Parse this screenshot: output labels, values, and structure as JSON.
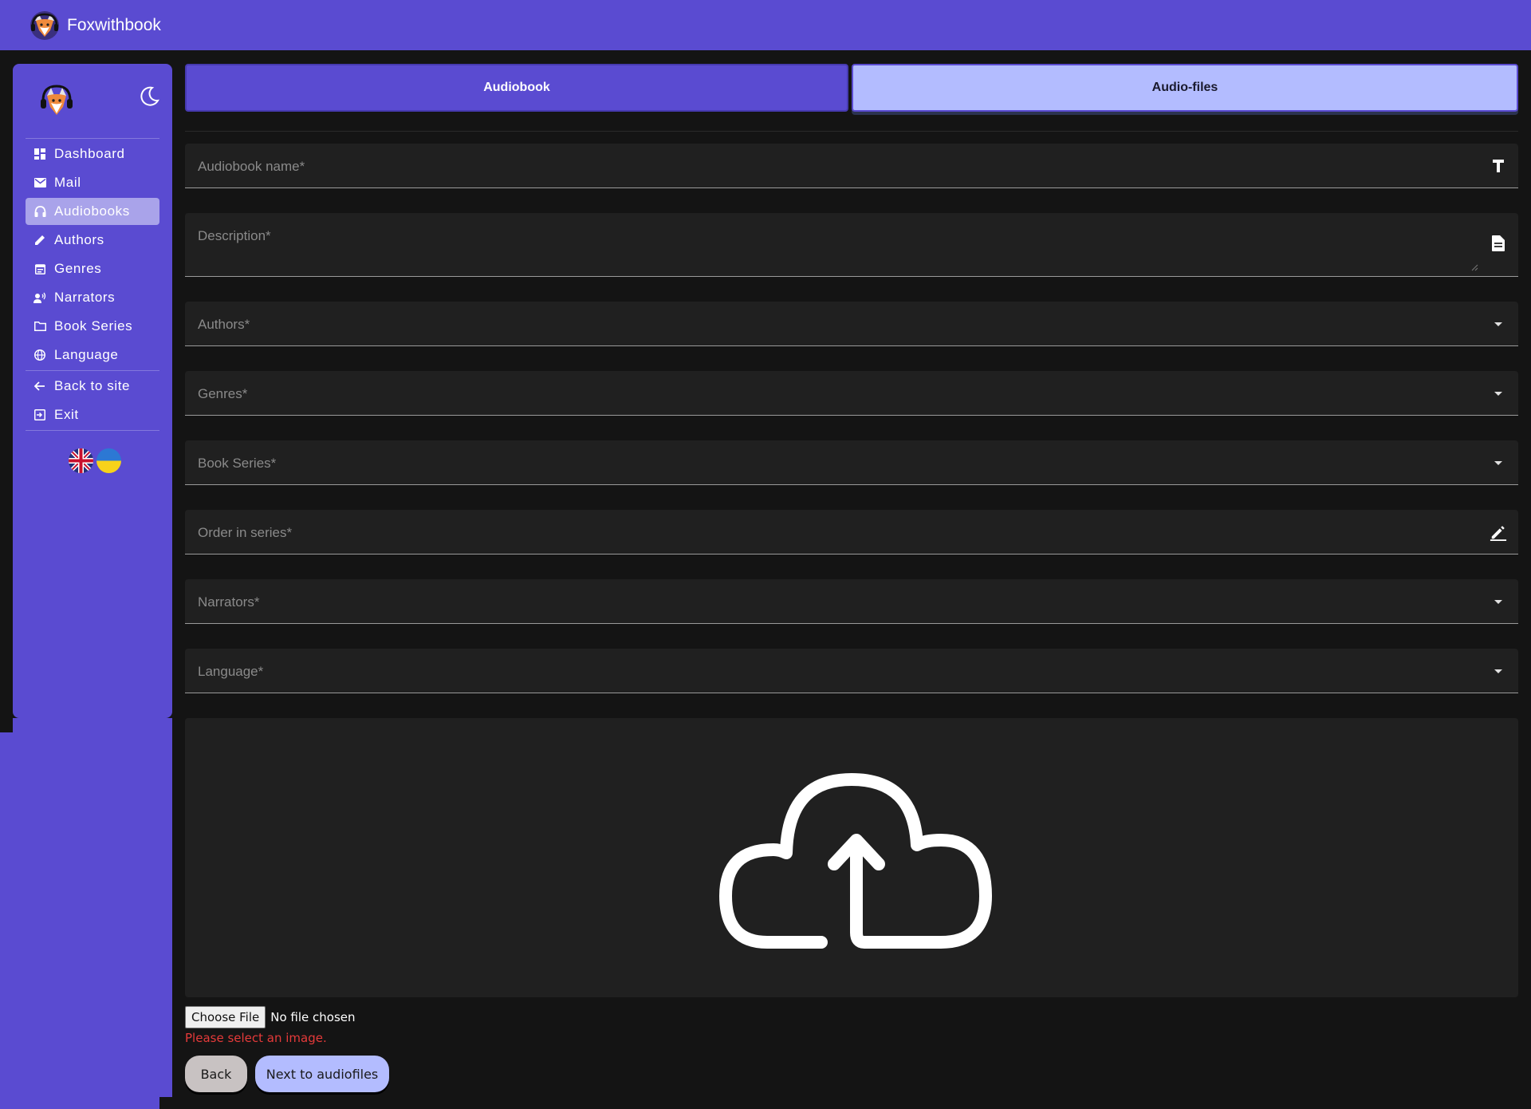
{
  "app": {
    "brand": "Foxwithbook"
  },
  "sidebar": {
    "items": [
      {
        "label": "Dashboard",
        "icon": "dashboard-icon"
      },
      {
        "label": "Mail",
        "icon": "mail-icon"
      },
      {
        "label": "Audiobooks",
        "icon": "headphones-icon",
        "active": true
      },
      {
        "label": "Authors",
        "icon": "pencil-icon"
      },
      {
        "label": "Genres",
        "icon": "calendar-icon"
      },
      {
        "label": "Narrators",
        "icon": "voice-icon"
      },
      {
        "label": "Book Series",
        "icon": "folder-icon"
      },
      {
        "label": "Language",
        "icon": "globe-icon"
      },
      {
        "label": "Back to site",
        "icon": "arrow-left-icon"
      },
      {
        "label": "Exit",
        "icon": "exit-icon"
      }
    ]
  },
  "tabs": [
    {
      "label": "Audiobook",
      "active": true
    },
    {
      "label": "Audio-files",
      "active": false
    }
  ],
  "form": {
    "audiobook_name": "Audiobook name*",
    "description": "Description*",
    "authors": "Authors*",
    "genres": "Genres*",
    "book_series": "Book Series*",
    "order_in_series": "Order in series*",
    "narrators": "Narrators*",
    "language": "Language*"
  },
  "file": {
    "choose_label": "Choose File",
    "status": "No file chosen",
    "error": "Please select an image."
  },
  "buttons": {
    "back": "Back",
    "next": "Next to audiofiles"
  },
  "colors": {
    "primary": "#5a4bd1",
    "accent_light": "#b3bcff",
    "background": "#141414",
    "field": "#202020",
    "error": "#e53a3a"
  }
}
